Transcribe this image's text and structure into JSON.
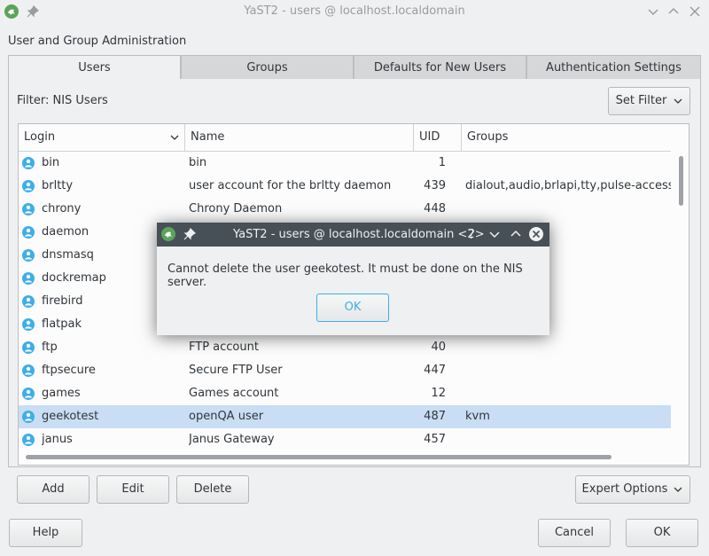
{
  "window": {
    "title": "YaST2 - users @ localhost.localdomain",
    "section_title": "User and Group Administration"
  },
  "tabs": [
    {
      "label": "Users"
    },
    {
      "label": "Groups"
    },
    {
      "label": "Defaults for New Users"
    },
    {
      "label": "Authentication Settings"
    }
  ],
  "filter": {
    "label": "Filter: NIS Users",
    "button_label": "Set Filter"
  },
  "table": {
    "columns": [
      "Login",
      "Name",
      "UID",
      "Groups"
    ],
    "rows": [
      {
        "login": "bin",
        "name": "bin",
        "uid": "1",
        "groups": ""
      },
      {
        "login": "brltty",
        "name": "user account for the brltty daemon",
        "uid": "439",
        "groups": "dialout,audio,brlapi,tty,pulse-access,ro"
      },
      {
        "login": "chrony",
        "name": "Chrony Daemon",
        "uid": "448",
        "groups": ""
      },
      {
        "login": "daemon",
        "name": "",
        "uid": "",
        "groups": ""
      },
      {
        "login": "dnsmasq",
        "name": "",
        "uid": "",
        "groups": ""
      },
      {
        "login": "dockremap",
        "name": "",
        "uid": "",
        "groups": ""
      },
      {
        "login": "firebird",
        "name": "",
        "uid": "",
        "groups": ""
      },
      {
        "login": "flatpak",
        "name": "",
        "uid": "",
        "groups": ""
      },
      {
        "login": "ftp",
        "name": "FTP account",
        "uid": "40",
        "groups": ""
      },
      {
        "login": "ftpsecure",
        "name": "Secure FTP User",
        "uid": "447",
        "groups": ""
      },
      {
        "login": "games",
        "name": "Games account",
        "uid": "12",
        "groups": ""
      },
      {
        "login": "geekotest",
        "name": "openQA user",
        "uid": "487",
        "groups": "kvm",
        "selected": true
      },
      {
        "login": "janus",
        "name": "Janus Gateway",
        "uid": "457",
        "groups": ""
      }
    ]
  },
  "buttons": {
    "add": "Add",
    "edit": "Edit",
    "delete": "Delete",
    "expert": "Expert Options",
    "help": "Help",
    "cancel": "Cancel",
    "ok": "OK"
  },
  "dialog": {
    "title": "YaST2 - users @ localhost.localdomain <2>",
    "message": "Cannot delete the user geekotest. It must be done on the NIS server.",
    "ok": "OK",
    "help_glyph": "?"
  },
  "colors": {
    "selection": "#c9def4",
    "accent": "#3daee9",
    "dialog_titlebar": "#475057"
  }
}
